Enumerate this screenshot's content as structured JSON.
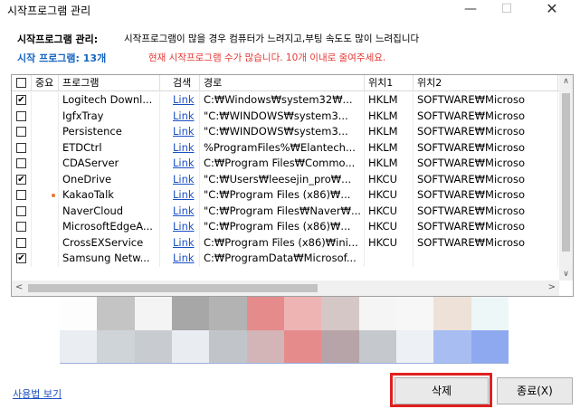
{
  "window": {
    "title": "시작프로그램 관리",
    "minimize": "—",
    "maximize": "☐",
    "close": "✕"
  },
  "header": {
    "label": "시작프로그램 관리:",
    "message": "시작프로그램이 많을 경우 컴퓨터가 느려지고,부팅 속도도 많이 느려집니다",
    "count_label": "시작 프로그램: 13개",
    "warning": "현재 시작프로그램 수가 많습니다. 10개 이내로 줄여주세요."
  },
  "table": {
    "columns": [
      "",
      "중요",
      "프로그램",
      "검색",
      "경로",
      "위치1",
      "위치2"
    ],
    "rows": [
      {
        "checked": true,
        "important": false,
        "program": "Logitech Downl...",
        "search": "Link",
        "path": "C:₩Windows₩system32₩...",
        "loc1": "HKLM",
        "loc2": "SOFTWARE₩Microso"
      },
      {
        "checked": false,
        "important": false,
        "program": "IgfxTray",
        "search": "Link",
        "path": "\"C:₩WINDOWS₩system3...",
        "loc1": "HKLM",
        "loc2": "SOFTWARE₩Microso"
      },
      {
        "checked": false,
        "important": false,
        "program": "Persistence",
        "search": "Link",
        "path": "\"C:₩WINDOWS₩system3...",
        "loc1": "HKLM",
        "loc2": "SOFTWARE₩Microso"
      },
      {
        "checked": false,
        "important": false,
        "program": "ETDCtrl",
        "search": "Link",
        "path": "%ProgramFiles%₩Elantech...",
        "loc1": "HKLM",
        "loc2": "SOFTWARE₩Microso"
      },
      {
        "checked": false,
        "important": false,
        "program": "CDAServer",
        "search": "Link",
        "path": "C:₩Program Files₩Commo...",
        "loc1": "HKLM",
        "loc2": "SOFTWARE₩Microso"
      },
      {
        "checked": true,
        "important": false,
        "program": "OneDrive",
        "search": "Link",
        "path": "\"C:₩Users₩leesejin_pro₩...",
        "loc1": "HKCU",
        "loc2": "SOFTWARE₩Microso"
      },
      {
        "checked": false,
        "important": true,
        "program": "KakaoTalk",
        "search": "Link",
        "path": "\"C:₩Program Files (x86)₩...",
        "loc1": "HKCU",
        "loc2": "SOFTWARE₩Microso"
      },
      {
        "checked": false,
        "important": false,
        "program": "NaverCloud",
        "search": "Link",
        "path": "\"C:₩Program Files₩Naver₩...",
        "loc1": "HKCU",
        "loc2": "SOFTWARE₩Microso"
      },
      {
        "checked": false,
        "important": false,
        "program": "MicrosoftEdgeA...",
        "search": "Link",
        "path": "\"C:₩Program Files (x86)₩...",
        "loc1": "HKCU",
        "loc2": "SOFTWARE₩Microso"
      },
      {
        "checked": false,
        "important": false,
        "program": "CrossEXService",
        "search": "Link",
        "path": "C:₩Program Files (x86)₩ini...",
        "loc1": "HKCU",
        "loc2": "SOFTWARE₩Microso"
      },
      {
        "checked": true,
        "important": false,
        "program": "Samsung Netw...",
        "search": "Link",
        "path": "C:₩ProgramData₩Microsof...",
        "loc1": "",
        "loc2": ""
      }
    ]
  },
  "mosaic_colors": [
    "#fdfdfd",
    "#c4c4c4",
    "#f4f4f4",
    "#a7a7a7",
    "#b3b3b3",
    "#e58b8b",
    "#eeb4b4",
    "#d6c7c7",
    "#f5f5f5",
    "#f7f7f7",
    "#ede1d8",
    "#edf7f8",
    "#eaeef2",
    "#cfd4d8",
    "#c8cbcf",
    "#e9ecf1",
    "#c1c5ca",
    "#d3b5b8",
    "#e68b8b",
    "#b7a4a8",
    "#c5c8cc",
    "#edf0f4",
    "#a8bef2",
    "#8fa9f0"
  ],
  "footer": {
    "user_view": "사용법 보기",
    "delete_label": "삭제",
    "exit_label": "종료(X)"
  },
  "scroll": {
    "up": "∧",
    "down": "∨",
    "left": "<",
    "right": ">"
  },
  "accent": {
    "highlight": "#e02020",
    "link": "#1a4fc4"
  }
}
